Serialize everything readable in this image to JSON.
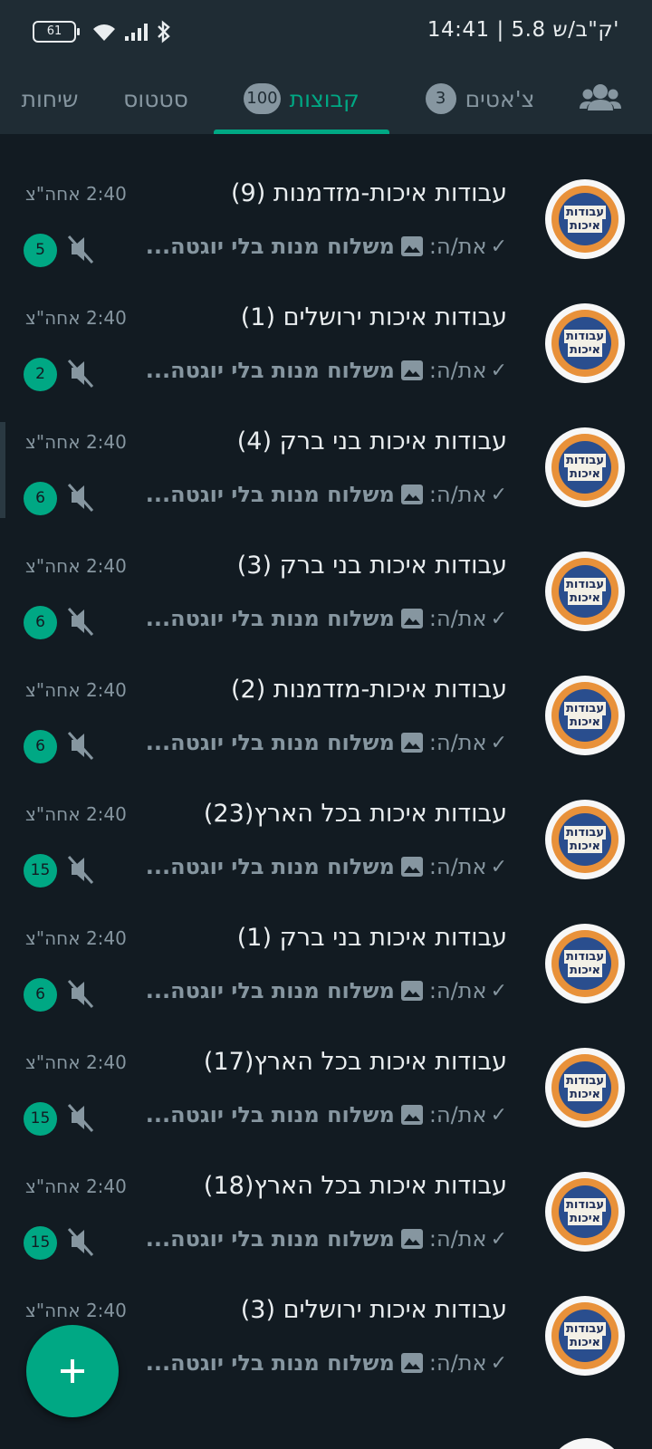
{
  "status_bar": {
    "time": "14:41 | 5.8 ק\"ב/ש'",
    "battery": "61"
  },
  "tabs": [
    {
      "label": "שיחות",
      "badge": null,
      "active": false
    },
    {
      "label": "סטטוס",
      "badge": null,
      "active": false
    },
    {
      "label": "קבוצות",
      "badge": "100",
      "active": true
    },
    {
      "label": "צ'אטים",
      "badge": "3",
      "active": false
    }
  ],
  "avatar_text": {
    "line1": "עבודות",
    "line2": "איכות"
  },
  "chats": [
    {
      "title": "עבודות איכות-מזדמנות (9)",
      "time": "2:40 אחה\"צ",
      "sender": "את/ה:",
      "message": "משלוח מנות בלי יוגטה...",
      "unread": "5"
    },
    {
      "title": "עבודות איכות ירושלים (1)",
      "time": "2:40 אחה\"צ",
      "sender": "את/ה:",
      "message": "משלוח מנות בלי יוגטה...",
      "unread": "2"
    },
    {
      "title": "עבודות איכות בני ברק (4)",
      "time": "2:40 אחה\"צ",
      "sender": "את/ה:",
      "message": "משלוח מנות בלי יוגטה...",
      "unread": "6"
    },
    {
      "title": "עבודות איכות בני ברק (3)",
      "time": "2:40 אחה\"צ",
      "sender": "את/ה:",
      "message": "משלוח מנות בלי יוגטה...",
      "unread": "6"
    },
    {
      "title": "עבודות איכות-מזדמנות (2)",
      "time": "2:40 אחה\"צ",
      "sender": "את/ה:",
      "message": "משלוח מנות בלי יוגטה...",
      "unread": "6"
    },
    {
      "title": "עבודות איכות בכל הארץ(23)",
      "time": "2:40 אחה\"צ",
      "sender": "את/ה:",
      "message": "משלוח מנות בלי יוגטה...",
      "unread": "15"
    },
    {
      "title": "עבודות איכות בני ברק (1)",
      "time": "2:40 אחה\"צ",
      "sender": "את/ה:",
      "message": "משלוח מנות בלי יוגטה...",
      "unread": "6"
    },
    {
      "title": "עבודות איכות בכל הארץ(17)",
      "time": "2:40 אחה\"צ",
      "sender": "את/ה:",
      "message": "משלוח מנות בלי יוגטה...",
      "unread": "15"
    },
    {
      "title": "עבודות איכות בכל הארץ(18)",
      "time": "2:40 אחה\"צ",
      "sender": "את/ה:",
      "message": "משלוח מנות בלי יוגטה...",
      "unread": "15"
    },
    {
      "title": "עבודות איכות ירושלים (3)",
      "time": "2:40 אחה\"צ",
      "sender": "את/ה:",
      "message": "משלוח מנות בלי יוגטה...",
      "unread": ""
    }
  ],
  "fab": {
    "icon": "plus-icon"
  },
  "colors": {
    "accent": "#00a884",
    "background": "#121b22",
    "header": "#1f2c34",
    "muted_text": "#8696a0"
  }
}
